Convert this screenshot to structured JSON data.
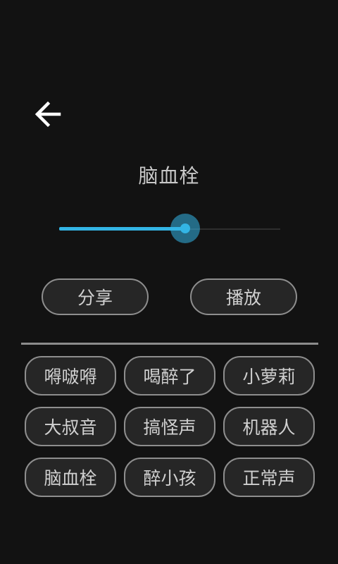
{
  "header": {
    "back_icon": "arrow-left-icon"
  },
  "title": "脑血栓",
  "slider": {
    "progress_percent": 57,
    "accent_color": "#33b5e5"
  },
  "actions": {
    "share_label": "分享",
    "play_label": "播放"
  },
  "effects": [
    {
      "label": "嘚啵嘚"
    },
    {
      "label": "喝醉了"
    },
    {
      "label": "小萝莉"
    },
    {
      "label": "大叔音"
    },
    {
      "label": "搞怪声"
    },
    {
      "label": "机器人"
    },
    {
      "label": "脑血栓"
    },
    {
      "label": "醉小孩"
    },
    {
      "label": "正常声"
    }
  ]
}
